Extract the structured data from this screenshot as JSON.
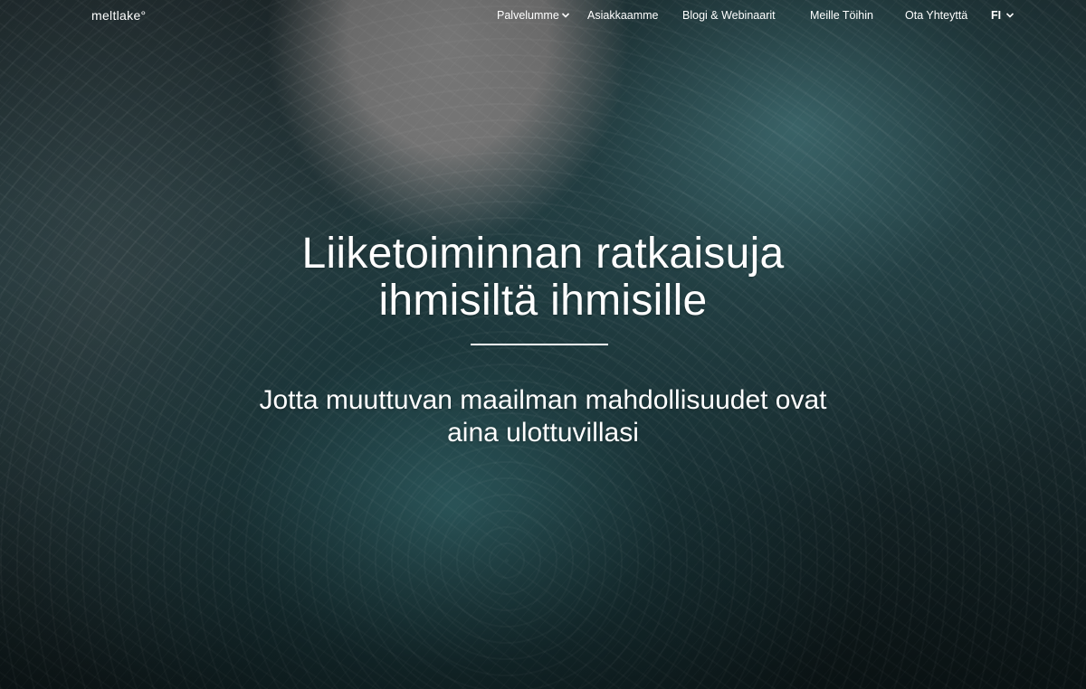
{
  "header": {
    "logo": "meltlake°",
    "nav": [
      {
        "label": "Palvelumme",
        "has_dropdown": true,
        "icon": "chevron-down-icon"
      },
      {
        "label": "Asiakkaamme"
      },
      {
        "label": "Blogi & Webinaarit"
      },
      {
        "label": "Meille Töihin"
      },
      {
        "label": "Ota Yhteyttä"
      }
    ],
    "language": {
      "label": "FI",
      "icon": "chevron-down-icon"
    }
  },
  "hero": {
    "headline_line1": "Liiketoiminnan ratkaisuja",
    "headline_line2": "ihmisiltä ihmisille",
    "subheadline_line1": "Jotta muuttuvan maailman mahdollisuudet ovat",
    "subheadline_line2": "aina ulottuvillasi",
    "background_image": "ice-cave-photo"
  },
  "colors": {
    "text": "#ffffff",
    "background_dark": "#1e2a2d",
    "background_teal": "#3f7a7e",
    "sky_gray": "#8b8b8b"
  }
}
